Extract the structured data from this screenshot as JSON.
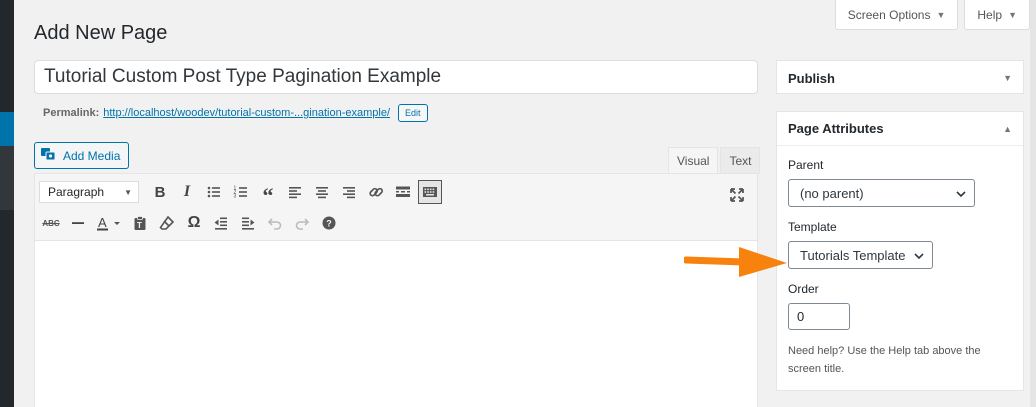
{
  "header": {
    "screen_options": "Screen Options",
    "help": "Help",
    "page_title": "Add New Page"
  },
  "post": {
    "title_value": "Tutorial Custom Post Type Pagination Example",
    "permalink_label": "Permalink:",
    "permalink_url": "http://localhost/woodev/tutorial-custom-...gination-example/",
    "edit_label": "Edit"
  },
  "media": {
    "add_media_label": "Add Media"
  },
  "editor": {
    "tabs": [
      "Visual",
      "Text"
    ],
    "format_select": "Paragraph",
    "toolbar_row1": [
      "bold-icon",
      "italic-icon",
      "bullet-list-icon",
      "numbered-list-icon",
      "blockquote-icon",
      "align-left-icon",
      "align-center-icon",
      "align-right-icon",
      "link-icon",
      "read-more-icon",
      "toolbar-toggle-icon"
    ],
    "toolbar_row2": [
      "strikethrough-icon",
      "horizontal-line-icon",
      "text-color-icon",
      "paste-text-icon",
      "clear-formatting-icon",
      "special-character-icon",
      "outdent-icon",
      "indent-icon",
      "undo-icon",
      "redo-icon",
      "keyboard-shortcuts-icon"
    ]
  },
  "sidebar": {
    "publish_title": "Publish",
    "attributes_title": "Page Attributes",
    "parent_label": "Parent",
    "parent_value": "(no parent)",
    "template_label": "Template",
    "template_value": "Tutorials Template",
    "order_label": "Order",
    "order_value": "0",
    "help_text": "Need help? Use the Help tab above the screen title."
  },
  "colors": {
    "accent": "#0073aa",
    "arrow": "#f7830e",
    "admin_bar": "#23282d"
  }
}
